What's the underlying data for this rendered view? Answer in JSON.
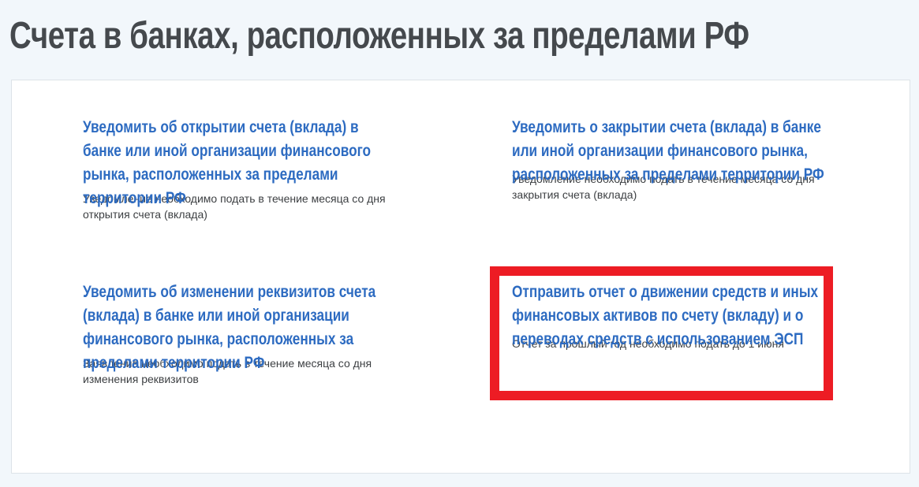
{
  "page": {
    "title": "Счета в банках, расположенных за пределами РФ"
  },
  "cards": [
    {
      "title_lines": [
        "Уведомить об открытии счета (вклада) в",
        "банке или иной организации финансового",
        "рынка, расположенных за пределами",
        "территории РФ"
      ],
      "desc_lines": [
        "Уведомление необходимо подать в течение месяца со дня",
        "открытия счета (вклада)"
      ]
    },
    {
      "title_lines": [
        "Уведомить о закрытии счета (вклада) в банке",
        "или иной организации финансового рынка,",
        "расположенных за пределами территории РФ"
      ],
      "desc_lines": [
        "Уведомление необходимо подать в течение месяца со дня",
        "закрытия счета (вклада)"
      ]
    },
    {
      "title_lines": [
        "Уведомить об изменении реквизитов счета",
        "(вклада) в банке или иной организации",
        "финансового рынка, расположенных за",
        "пределами территории РФ"
      ],
      "desc_lines": [
        "Заявление необходимо подать в течение месяца со дня",
        "изменения реквизитов"
      ]
    },
    {
      "title_lines": [
        "Отправить отчет о движении средств и иных",
        "финансовых активов по счету (вкладу) и о",
        "переводах средств с использованием ЭСП"
      ],
      "desc_lines": [
        "Отчет за прошлый год необходимо подать до 1 июня"
      ]
    }
  ],
  "colors": {
    "link": "#2d6bc1",
    "title": "#45494d",
    "highlight": "#ed1c24",
    "background": "#f2f7fb"
  }
}
